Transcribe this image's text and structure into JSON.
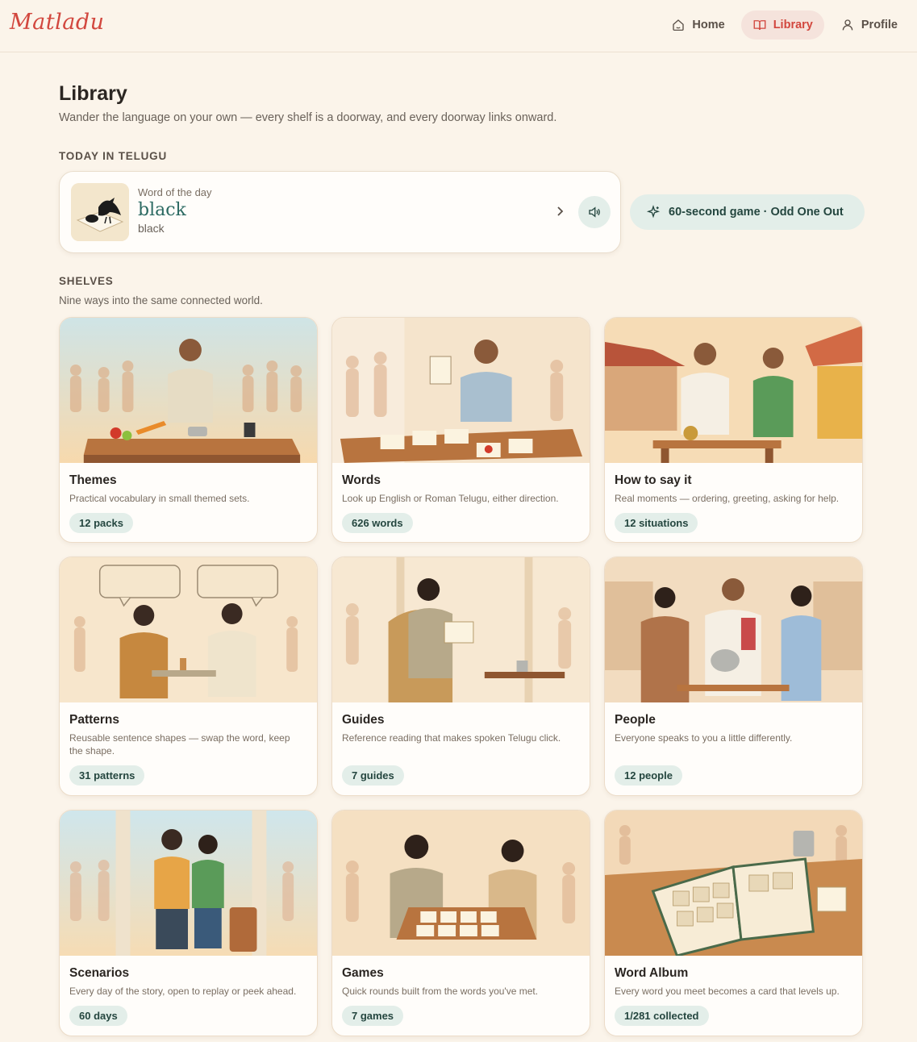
{
  "app": {
    "logo": "Matladu",
    "nav": [
      {
        "label": "Home",
        "icon": "home-icon",
        "active": false
      },
      {
        "label": "Library",
        "icon": "book-icon",
        "active": true
      },
      {
        "label": "Profile",
        "icon": "user-icon",
        "active": false
      }
    ]
  },
  "page": {
    "title": "Library",
    "subtitle": "Wander the language on your own — every shelf is a doorway, and every doorway links onward."
  },
  "today": {
    "label": "TODAY IN TELUGU",
    "word_of_day": {
      "kicker": "Word of the day",
      "word": "black",
      "translation": "black",
      "thumb_icon": "crow-icon"
    },
    "game_pill": "60-second game · Odd One Out"
  },
  "shelves": {
    "label": "SHELVES",
    "subtitle": "Nine ways into the same connected world.",
    "cards": [
      {
        "title": "Themes",
        "description": "Practical vocabulary in small themed sets.",
        "pill": "12 packs"
      },
      {
        "title": "Words",
        "description": "Look up English or Roman Telugu, either direction.",
        "pill": "626 words"
      },
      {
        "title": "How to say it",
        "description": "Real moments — ordering, greeting, asking for help.",
        "pill": "12 situations"
      },
      {
        "title": "Patterns",
        "description": "Reusable sentence shapes — swap the word, keep the shape.",
        "pill": "31 patterns"
      },
      {
        "title": "Guides",
        "description": "Reference reading that makes spoken Telugu click.",
        "pill": "7 guides"
      },
      {
        "title": "People",
        "description": "Everyone speaks to you a little differently.",
        "pill": "12 people"
      },
      {
        "title": "Scenarios",
        "description": "Every day of the story, open to replay or peek ahead.",
        "pill": "60 days"
      },
      {
        "title": "Games",
        "description": "Quick rounds built from the words you've met.",
        "pill": "7 games"
      },
      {
        "title": "Word Album",
        "description": "Every word you meet becomes a card that levels up.",
        "pill": "1/281 collected"
      }
    ]
  },
  "colors": {
    "background": "#fbf4ea",
    "accent": "#d2473e",
    "teal": "#2c6a62",
    "pill_bg": "#e3eee9"
  }
}
